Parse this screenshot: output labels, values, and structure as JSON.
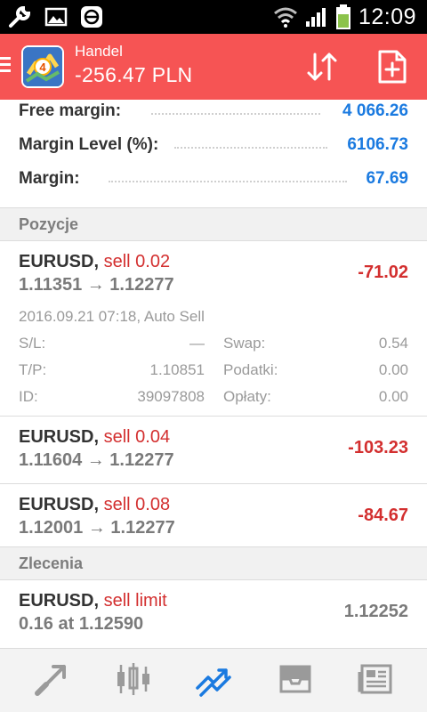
{
  "status_bar": {
    "time": "12:09",
    "icons": [
      "wrench-icon",
      "image-icon",
      "e-app-icon",
      "wifi-icon",
      "signal-icon",
      "battery-icon"
    ]
  },
  "app_bar": {
    "title": "Handel",
    "value": "-256.47 PLN",
    "bg_color": "#f65454",
    "icons": [
      "menu-icon",
      "metatrader-logo",
      "sort-icon",
      "new-order-icon"
    ]
  },
  "account": {
    "rows": [
      {
        "label": "Free margin:",
        "value": "4 066.26"
      },
      {
        "label": "Margin Level (%):",
        "value": "6106.73"
      },
      {
        "label": "Margin:",
        "value": "67.69"
      }
    ],
    "value_color": "#1a7ae0"
  },
  "positions_section": {
    "title": "Pozycje",
    "items": [
      {
        "symbol": "EURUSD,",
        "side": "sell 0.02",
        "prices": "1.11351 → 1.12277",
        "profit": "-71.02",
        "expanded": true,
        "meta": "2016.09.21 07:18, Auto Sell",
        "details": {
          "sl_label": "S/L:",
          "sl_value": "—",
          "swap_label": "Swap:",
          "swap_value": "0.54",
          "tp_label": "T/P:",
          "tp_value": "1.10851",
          "tax_label": "Podatki:",
          "tax_value": "0.00",
          "id_label": "ID:",
          "id_value": "39097808",
          "fee_label": "Opłaty:",
          "fee_value": "0.00"
        }
      },
      {
        "symbol": "EURUSD,",
        "side": "sell 0.04",
        "prices": "1.11604 → 1.12277",
        "profit": "-103.23"
      },
      {
        "symbol": "EURUSD,",
        "side": "sell 0.08",
        "prices": "1.12001 → 1.12277",
        "profit": "-84.67"
      }
    ]
  },
  "orders_section": {
    "title": "Zlecenia",
    "items": [
      {
        "symbol": "EURUSD,",
        "side": "sell limit",
        "details": "0.16 at 1.12590",
        "price": "1.12252"
      }
    ]
  },
  "bottom_nav": {
    "items": [
      {
        "name": "quotes-icon",
        "active": false
      },
      {
        "name": "chart-candles-icon",
        "active": false
      },
      {
        "name": "trade-icon",
        "active": true
      },
      {
        "name": "history-inbox-icon",
        "active": false
      },
      {
        "name": "news-icon",
        "active": false
      }
    ],
    "active_color": "#1a7ae0",
    "inactive_color": "#9a9a9a"
  }
}
